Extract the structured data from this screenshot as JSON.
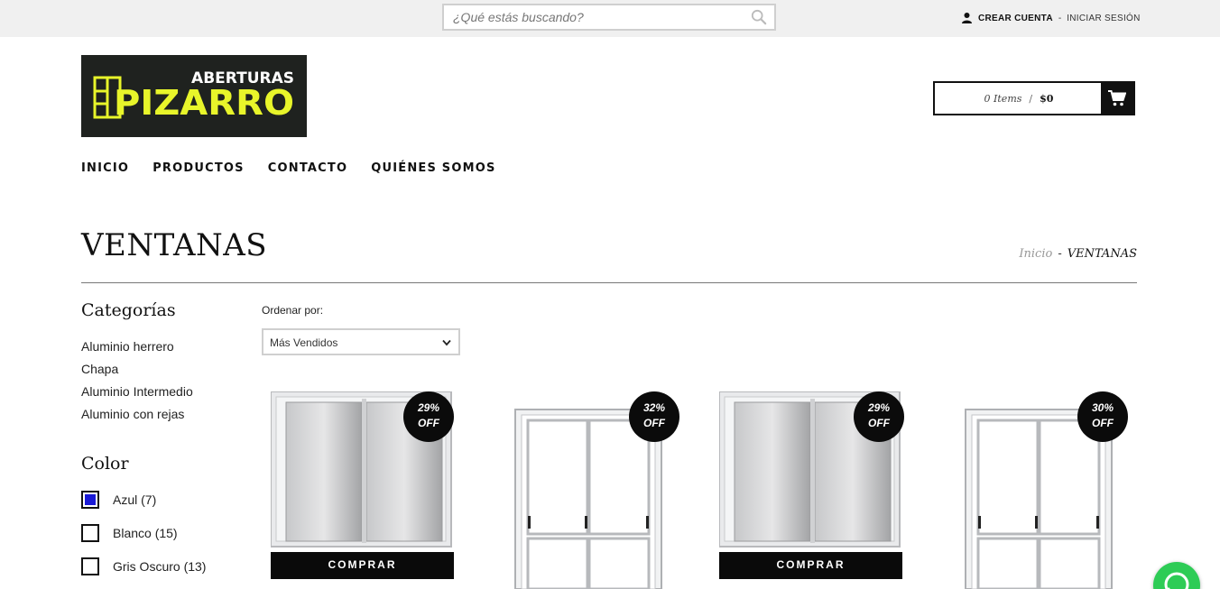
{
  "topbar": {
    "search_placeholder": "¿Qué estás buscando?",
    "icons": {
      "search": "search-icon",
      "user": "user-icon"
    },
    "create_account": "CREAR CUENTA",
    "separator": "-",
    "login": "INICIAR SESIÓN"
  },
  "logo": {
    "line1": "ABERTURAS",
    "line2": "PIZARRO"
  },
  "cart": {
    "items": "0 Items",
    "slash": "/",
    "total": "$0",
    "icon": "cart-icon"
  },
  "nav": {
    "items": [
      "INICIO",
      "PRODUCTOS",
      "CONTACTO",
      "QUIÉNES SOMOS"
    ]
  },
  "page": {
    "title": "VENTANAS",
    "breadcrumb": {
      "home": "Inicio",
      "separator": "-",
      "current": "VENTANAS"
    }
  },
  "sidebar": {
    "categories_title": "Categorías",
    "categories": [
      "Aluminio herrero",
      "Chapa",
      "Aluminio Intermedio",
      "Aluminio con rejas"
    ],
    "color_title": "Color",
    "colors": [
      {
        "label": "Azul (7)",
        "swatch": "#1a1ad6",
        "selected": true
      },
      {
        "label": "Blanco (15)",
        "swatch": "",
        "selected": false
      },
      {
        "label": "Gris Oscuro (13)",
        "swatch": "",
        "selected": false
      }
    ]
  },
  "sort": {
    "label": "Ordenar por:",
    "selected": "Más Vendidos"
  },
  "products": [
    {
      "discount": "29%",
      "off": "OFF",
      "buy": "COMPRAR",
      "image": "sliding-window-glass"
    },
    {
      "discount": "32%",
      "off": "OFF",
      "buy": "",
      "image": "sliding-window-grid"
    },
    {
      "discount": "29%",
      "off": "OFF",
      "buy": "COMPRAR",
      "image": "sliding-window-glass"
    },
    {
      "discount": "30%",
      "off": "OFF",
      "buy": "",
      "image": "sliding-window-grid"
    }
  ],
  "colors": {
    "logo_bg": "#1f221f",
    "logo_accent": "#e8f52a",
    "dark": "#0a0a0a",
    "whatsapp": "#2ecc56"
  }
}
